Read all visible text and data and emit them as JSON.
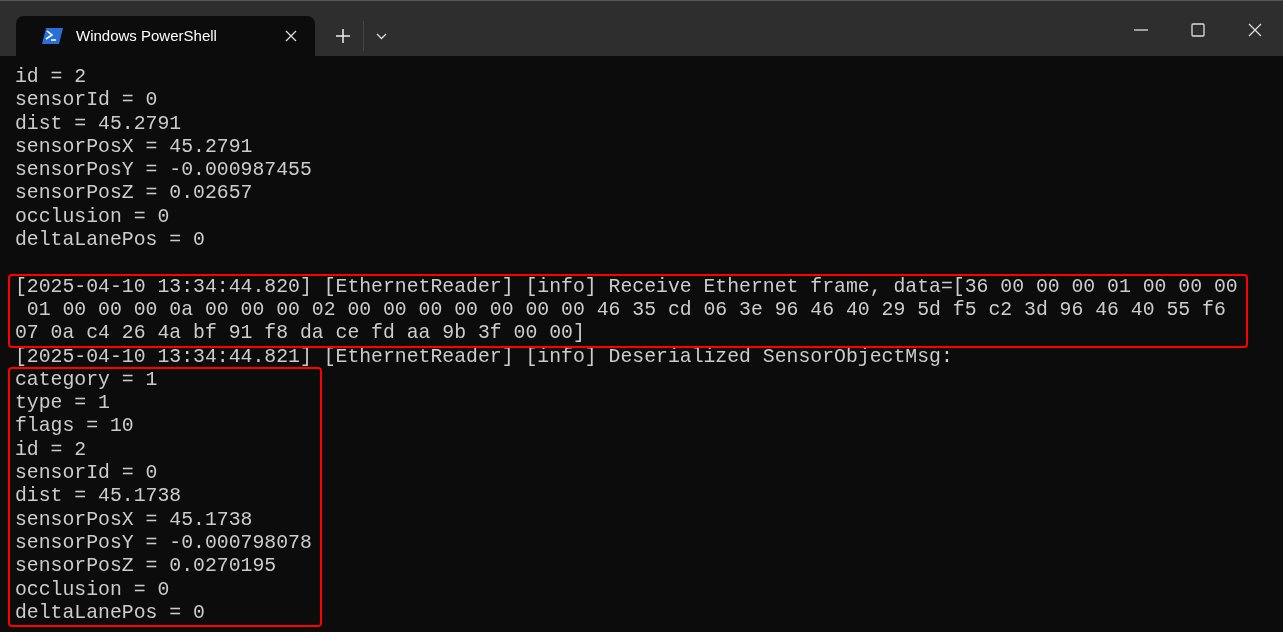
{
  "window": {
    "tab_title": "Windows PowerShell"
  },
  "terminal": {
    "blocks": [
      {
        "blank_line_before": false,
        "highlighted": false,
        "lines": [
          "id = 2",
          "sensorId = 0",
          "dist = 45.2791",
          "sensorPosX = 45.2791",
          "sensorPosY = -0.000987455",
          "sensorPosZ = 0.02657",
          "occlusion = 0",
          "deltaLanePos = 0"
        ]
      },
      {
        "blank_line_before": true,
        "highlighted": true,
        "lines": [
          "[2025-04-10 13:34:44.820] [EthernetReader] [info] Receive Ethernet frame, data=[36 00 00 00 01 00 00 00",
          " 01 00 00 00 0a 00 00 00 02 00 00 00 00 00 00 00 46 35 cd 06 3e 96 46 40 29 5d f5 c2 3d 96 46 40 55 f6",
          "07 0a c4 26 4a bf 91 f8 da ce fd aa 9b 3f 00 00]"
        ]
      },
      {
        "blank_line_before": false,
        "highlighted": false,
        "lines": [
          "[2025-04-10 13:34:44.821] [EthernetReader] [info] Deserialized SensorObjectMsg:"
        ]
      },
      {
        "blank_line_before": false,
        "highlighted": true,
        "lines": [
          "category = 1",
          "type = 1",
          "flags = 10",
          "id = 2",
          "sensorId = 0",
          "dist = 45.1738",
          "sensorPosX = 45.1738",
          "sensorPosY = -0.000798078",
          "sensorPosZ = 0.0270195",
          "occlusion = 0",
          "deltaLanePos = 0"
        ]
      }
    ]
  }
}
